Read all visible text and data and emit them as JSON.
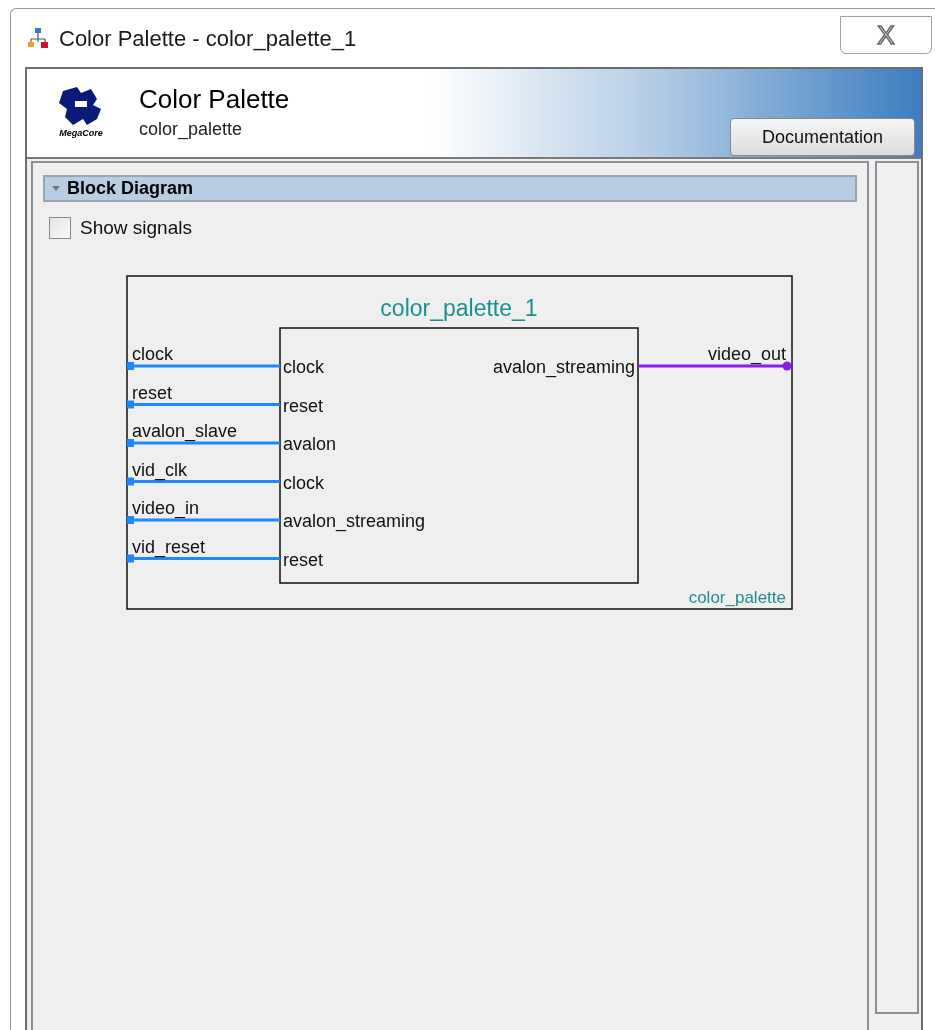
{
  "window": {
    "title": "Color Palette - color_palette_1",
    "close": "X"
  },
  "header": {
    "logo_text": "MegaCore",
    "title": "Color Palette",
    "subtitle": "color_palette",
    "button": "Documentation"
  },
  "section": {
    "title": "Block Diagram",
    "expanded": true
  },
  "show_signals": {
    "label": "Show signals",
    "checked": false
  },
  "diagram": {
    "instance": "color_palette_1",
    "module": "color_palette",
    "inputs": [
      {
        "external": "clock",
        "internal": "clock"
      },
      {
        "external": "reset",
        "internal": "reset"
      },
      {
        "external": "avalon_slave",
        "internal": "avalon"
      },
      {
        "external": "vid_clk",
        "internal": "clock"
      },
      {
        "external": "video_in",
        "internal": "avalon_streaming"
      },
      {
        "external": "vid_reset",
        "internal": "reset"
      }
    ],
    "outputs": [
      {
        "external": "video_out",
        "internal": "avalon_streaming"
      }
    ]
  }
}
